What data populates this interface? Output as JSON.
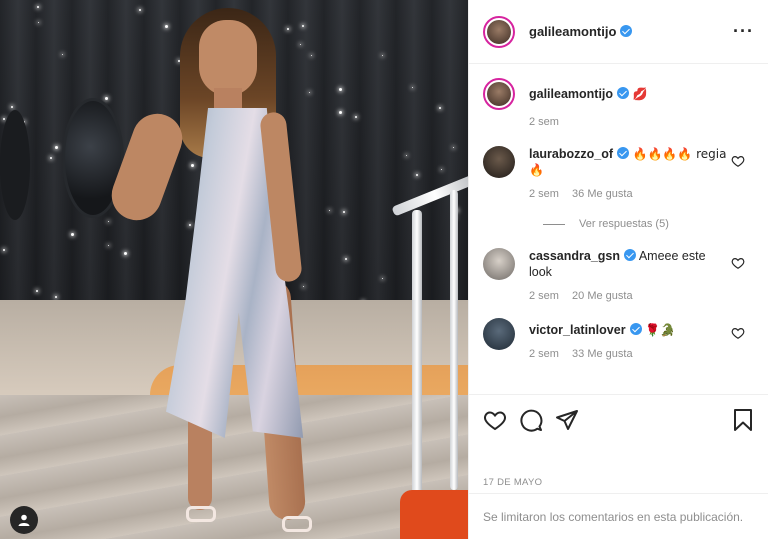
{
  "post": {
    "author": "galileamontijo",
    "caption_emoji": "💋",
    "caption_time": "2 sem",
    "date": "17 DE MAYO",
    "comments_limited": "Se limitaron los comentarios en esta publicación."
  },
  "comments": [
    {
      "user": "laurabozzo_of",
      "text": "🔥🔥🔥🔥 regia 🔥",
      "time": "2 sem",
      "likes": "36 Me gusta",
      "replies": "Ver respuestas (5)"
    },
    {
      "user": "cassandra_gsn",
      "text": "Ameee este look",
      "time": "2 sem",
      "likes": "20 Me gusta"
    },
    {
      "user": "victor_latinlover",
      "text": "🌹🐊",
      "time": "2 sem",
      "likes": "33 Me gusta"
    }
  ],
  "icons": {
    "like": "heart-icon",
    "comment": "comment-icon",
    "share": "paper-plane-icon",
    "save": "bookmark-icon",
    "more": "more-options-icon",
    "verified": "verified-badge-icon",
    "user_tags": "user-tag-icon"
  },
  "colors": {
    "verified": "#3897f0",
    "text": "#262626",
    "muted": "#8e8e8e",
    "story_ring": "#d6249f"
  }
}
